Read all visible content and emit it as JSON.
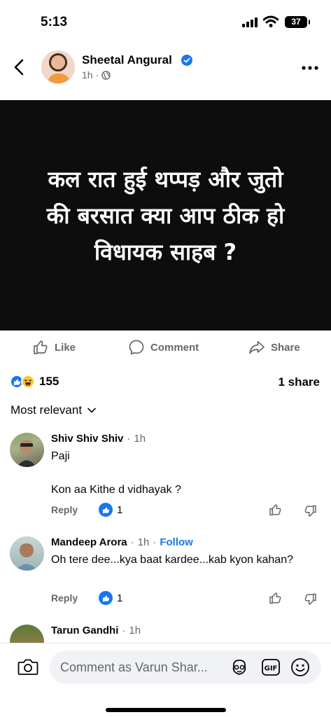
{
  "status_bar": {
    "time": "5:13",
    "battery": "37"
  },
  "post": {
    "author": "Sheetal Angural",
    "time": "1h",
    "image_text_lines": [
      "कल रात हुई थप्पड़ और जुतो",
      "की बरसात क्या आप ठीक हो",
      "विधायक साहब ?"
    ]
  },
  "actions": {
    "like": "Like",
    "comment": "Comment",
    "share": "Share"
  },
  "stats": {
    "reactions": "155",
    "shares": "1 share"
  },
  "sort": {
    "label": "Most relevant"
  },
  "comments": [
    {
      "name": "Shiv Shiv Shiv",
      "time": "1h",
      "follow": "",
      "lines": [
        "Paji",
        "Kon aa Kithe d vidhayak ?"
      ],
      "reply": "Reply",
      "likes": "1"
    },
    {
      "name": "Mandeep Arora",
      "time": "1h",
      "follow": "Follow",
      "lines": [
        "Oh tere dee...kya baat kardee...kab kyon kahan?"
      ],
      "reply": "Reply",
      "likes": "1"
    },
    {
      "name": "Tarun Gandhi",
      "time": "1h"
    }
  ],
  "composer": {
    "placeholder": "Comment as Varun Shar..."
  },
  "colors": {
    "accent": "#1877f2",
    "muted": "#65676b",
    "image_bg": "#0d0d0d"
  }
}
